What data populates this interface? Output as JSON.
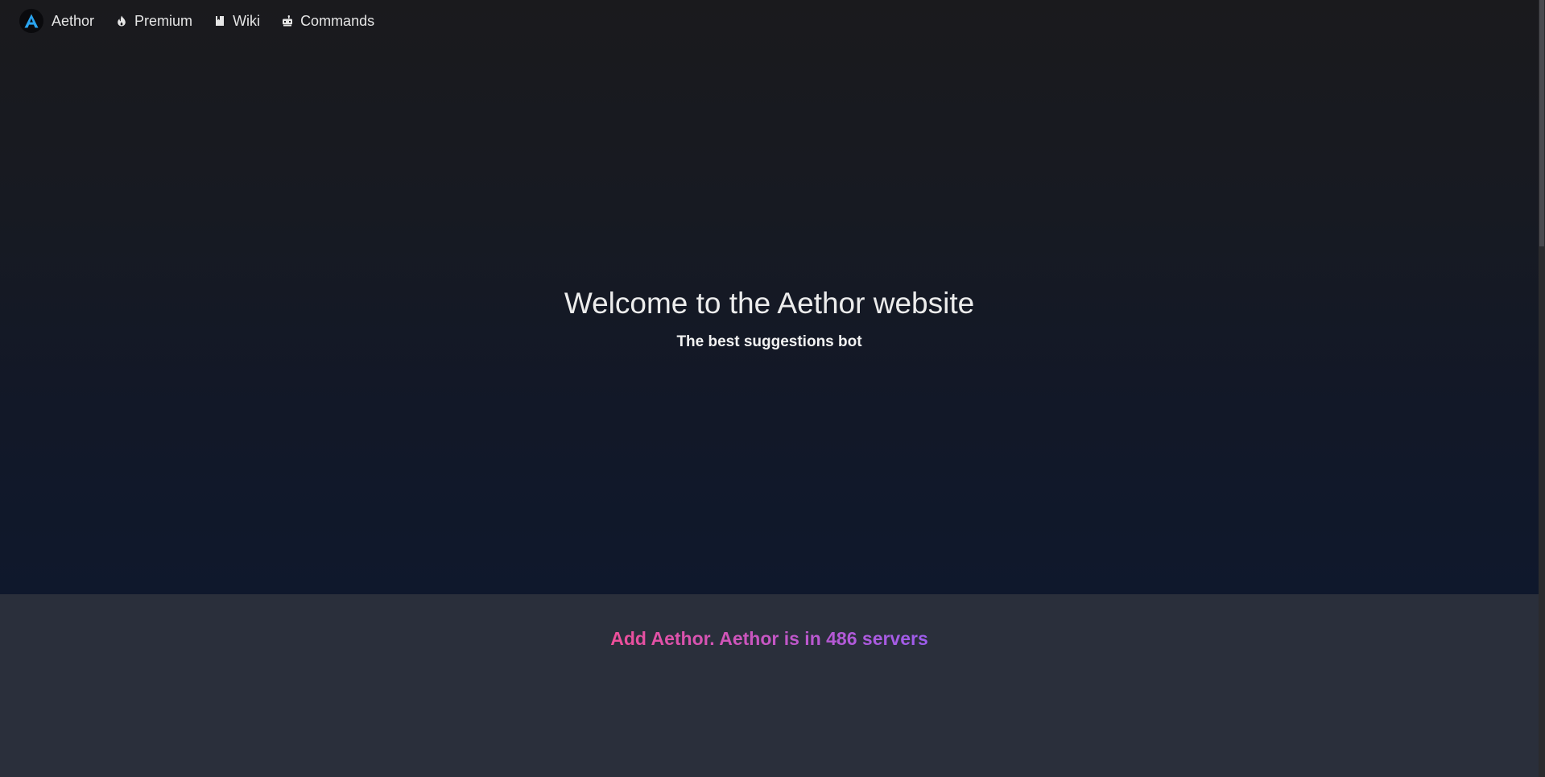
{
  "nav": {
    "brand": {
      "label": "Aethor",
      "logo_letter": "A"
    },
    "items": [
      {
        "label": "Premium",
        "icon": "fire-icon"
      },
      {
        "label": "Wiki",
        "icon": "book-icon"
      },
      {
        "label": "Commands",
        "icon": "robot-icon"
      }
    ]
  },
  "hero": {
    "title": "Welcome to the Aethor website",
    "subtitle": "The best suggestions bot"
  },
  "stats": {
    "text": "Add Aethor. Aethor is in 486 servers"
  },
  "colors": {
    "logo_accent": "#2aa4ef",
    "gradient_start": "#ee4f99",
    "gradient_end": "#9d5ded",
    "band_bg": "#2a2f3b"
  }
}
